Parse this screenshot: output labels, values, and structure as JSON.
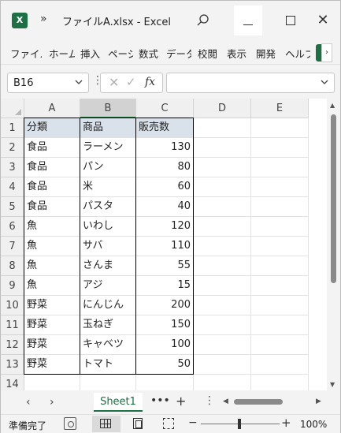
{
  "titlebar": {
    "app_icon_label": "X",
    "more_label": "»",
    "title": "ファイルA.xlsx  -  Excel",
    "close_label": "✕"
  },
  "ribbon": {
    "tabs": [
      "ファイル",
      "ホーム",
      "挿入",
      "ページ",
      "数式",
      "データ",
      "校閲",
      "表示",
      "開発",
      "ヘルプ"
    ],
    "scroll_label": "›"
  },
  "formula_bar": {
    "name_box": "B16",
    "fx_label": "fx",
    "cancel_label": "✕",
    "enter_label": "✓",
    "formula_value": ""
  },
  "sheet": {
    "columns": [
      "A",
      "B",
      "C",
      "D",
      "E"
    ],
    "selected_column": "B",
    "rows": [
      {
        "num": "1",
        "a": "分類",
        "b": "商品",
        "c": "販売数"
      },
      {
        "num": "2",
        "a": "食品",
        "b": "ラーメン",
        "c": "130"
      },
      {
        "num": "3",
        "a": "食品",
        "b": "パン",
        "c": "80"
      },
      {
        "num": "4",
        "a": "食品",
        "b": "米",
        "c": "60"
      },
      {
        "num": "5",
        "a": "食品",
        "b": "パスタ",
        "c": "40"
      },
      {
        "num": "6",
        "a": "魚",
        "b": "いわし",
        "c": "120"
      },
      {
        "num": "7",
        "a": "魚",
        "b": "サバ",
        "c": "110"
      },
      {
        "num": "8",
        "a": "魚",
        "b": "さんま",
        "c": "55"
      },
      {
        "num": "9",
        "a": "魚",
        "b": "アジ",
        "c": "15"
      },
      {
        "num": "10",
        "a": "野菜",
        "b": "にんじん",
        "c": "200"
      },
      {
        "num": "11",
        "a": "野菜",
        "b": "玉ねぎ",
        "c": "150"
      },
      {
        "num": "12",
        "a": "野菜",
        "b": "キャベツ",
        "c": "100"
      },
      {
        "num": "13",
        "a": "野菜",
        "b": "トマト",
        "c": "50"
      },
      {
        "num": "14",
        "a": "",
        "b": "",
        "c": ""
      }
    ],
    "header_fill": "#d9e1ea"
  },
  "sheet_tabs": {
    "prev_label": "‹",
    "next_label": "›",
    "active_sheet": "Sheet1",
    "more_label": "•••",
    "add_label": "+",
    "options_label": "⋮"
  },
  "status": {
    "ready": "準備完了",
    "zoom": "100%",
    "zoom_minus": "−",
    "zoom_plus": "+"
  },
  "colors": {
    "accent": "#1d7044"
  }
}
